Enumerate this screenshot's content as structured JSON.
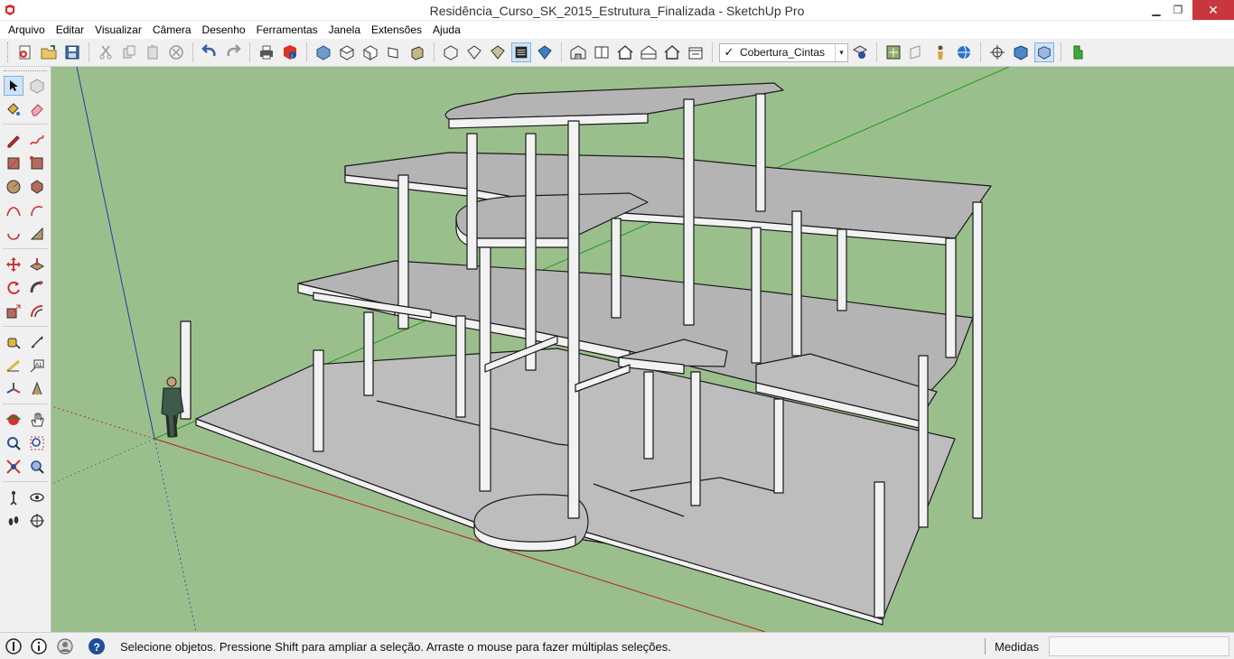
{
  "window": {
    "title": "Residência_Curso_SK_2015_Estrutura_Finalizada - SketchUp Pro",
    "minimize": "▁",
    "maximize": "❐",
    "close": "✕"
  },
  "menu": [
    "Arquivo",
    "Editar",
    "Visualizar",
    "Câmera",
    "Desenho",
    "Ferramentas",
    "Janela",
    "Extensões",
    "Ajuda"
  ],
  "toolbar": {
    "layer": {
      "current": "Cobertura_Cintas",
      "checked": "✓",
      "dropdown": "▾"
    }
  },
  "status": {
    "message": "Selecione objetos. Pressione Shift para ampliar a seleção. Arraste o mouse para fazer múltiplas seleções.",
    "measure_label": "Medidas",
    "measure_value": ""
  },
  "icons": {
    "top": [
      "new-model-icon",
      "open-icon",
      "save-icon",
      "cut-icon",
      "copy-icon",
      "paste-icon",
      "erase-icon",
      "undo-icon",
      "redo-icon",
      "print-icon",
      "model-info-icon",
      "iso-view-icon",
      "top-view-icon",
      "front-view-icon",
      "right-view-icon",
      "back-view-icon",
      "left-view-icon",
      "xray-icon",
      "back-edges-icon",
      "wireframe-icon",
      "hidden-line-icon",
      "shaded-icon",
      "shaded-textures-icon",
      "monochrome-icon",
      "warehouse-icon",
      "components-icon",
      "house-icon",
      "share-icon",
      "extension-icon",
      "layer-manager-icon"
    ],
    "colors": {
      "viewport": "#9abf8c",
      "slab": "#bdbdbd",
      "slab_top": "#b4b4b4",
      "beam": "#f2f2f2",
      "edge": "#1a1a1a"
    }
  }
}
